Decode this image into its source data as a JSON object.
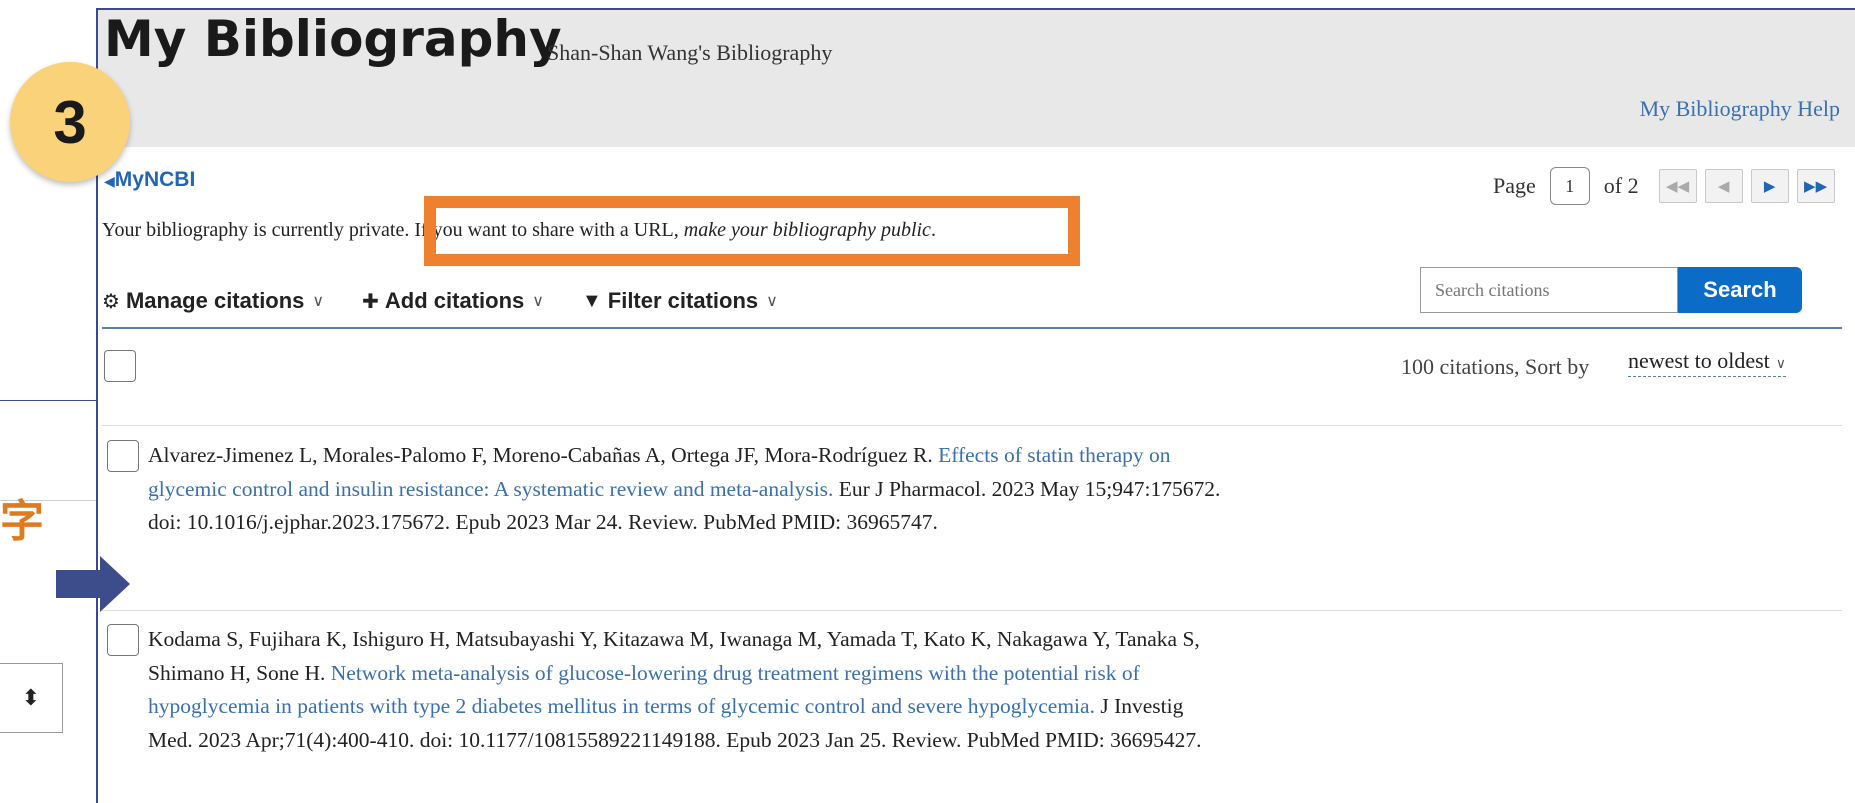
{
  "left_fragment": {
    "char": "字",
    "arrow_icon": "right-arrow-icon",
    "select_icon": "sort-updown-icon"
  },
  "header": {
    "title": "My Bibliography",
    "subtitle": "Shan-Shan Wang's Bibliography",
    "help_link": "My Bibliography Help"
  },
  "step_badge": "3",
  "nav": {
    "back_label": "MyNCBI",
    "back_icon": "caret-left-icon"
  },
  "privacy": {
    "text_before": "Your bibliography is currently private. If you want to share with a URL, ",
    "link_text": "make your bibliography public",
    "text_after": "."
  },
  "pager": {
    "page_label": "Page",
    "current_page": "1",
    "of_label": "of 2",
    "buttons": [
      "first-page-icon",
      "prev-page-icon",
      "next-page-icon",
      "last-page-icon"
    ]
  },
  "toolbar": {
    "manage_label": "Manage citations",
    "manage_icon": "gear-icon",
    "add_label": "Add citations",
    "add_icon": "plus-icon",
    "filter_label": "Filter citations",
    "filter_icon": "filter-icon"
  },
  "search": {
    "placeholder": "Search citations",
    "button_label": "Search"
  },
  "list_header": {
    "count_text": "100 citations, Sort by",
    "sort_value": "newest to oldest"
  },
  "citations": [
    {
      "authors": "Alvarez-Jimenez L, Morales-Palomo F, Moreno-Cabañas A, Ortega JF, Mora-Rodríguez R. ",
      "title": "Effects of statin therapy on glycemic control and insulin resistance: A systematic review and meta-analysis.",
      "details": " Eur J Pharmacol. 2023 May 15;947:175672. doi: 10.1016/j.ejphar.2023.175672. Epub 2023 Mar 24. Review. PubMed PMID: 36965747."
    },
    {
      "authors": "Kodama S, Fujihara K, Ishiguro H, Matsubayashi Y, Kitazawa M, Iwanaga M, Yamada T, Kato K, Nakagawa Y, Tanaka S, Shimano H, Sone H. ",
      "title": "Network meta-analysis of glucose-lowering drug treatment regimens with the potential risk of hypoglycemia in patients with type 2 diabetes mellitus in terms of glycemic control and severe hypoglycemia.",
      "details": " J Investig Med. 2023 Apr;71(4):400-410. doi: 10.1177/10815589221149188. Epub 2023 Jan 25. Review. PubMed PMID: 36695427."
    }
  ],
  "colors": {
    "link": "#3a6fb0",
    "search_button": "#0b6cc8",
    "highlight_box": "#ef8030",
    "badge": "#f9d27a"
  }
}
